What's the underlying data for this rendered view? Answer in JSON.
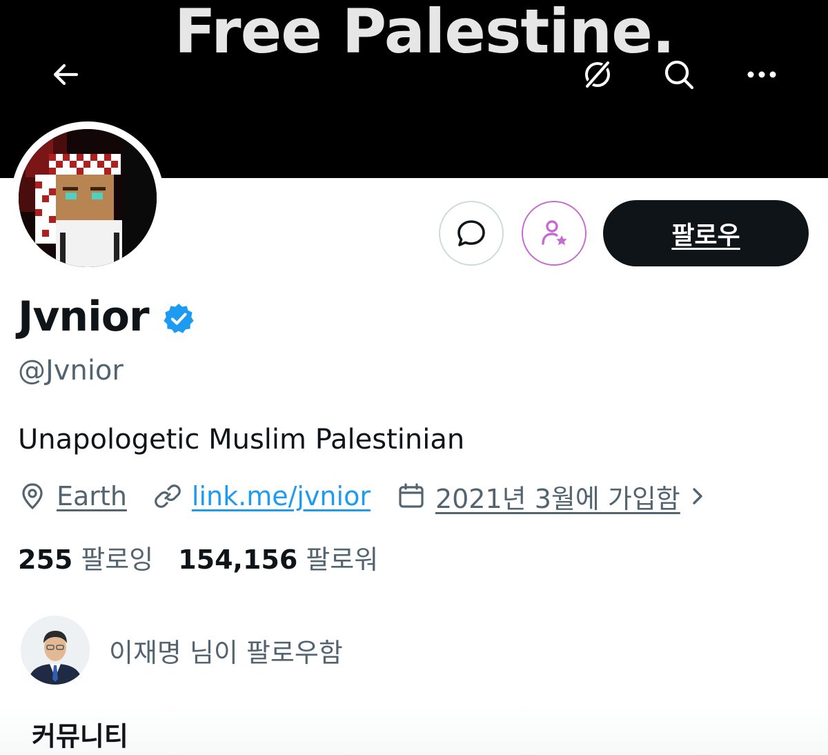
{
  "banner": {
    "text": "Free Palestine.",
    "icons": [
      "back-arrow-icon",
      "grok-icon",
      "search-icon",
      "more-icon"
    ]
  },
  "actions": {
    "follow_label": "팔로우",
    "dm_icon": "message-bubble-icon",
    "subscribe_icon": "subscribe-person-star-icon"
  },
  "profile": {
    "display_name": "Jvnior",
    "verified": true,
    "handle": "@Jvnior",
    "bio": "Unapologetic Muslim Palestinian",
    "location": "Earth",
    "link": "link.me/jvnior",
    "joined": "2021년 3월에 가입함"
  },
  "stats": {
    "following_count": "255",
    "following_label": "팔로잉",
    "followers_count": "154,156",
    "followers_label": "팔로워"
  },
  "followed_by": {
    "text": "이재명 님이 팔로우함"
  },
  "community": {
    "title": "커뮤니티"
  },
  "colors": {
    "banner_bg": "#000000",
    "text_primary": "#0f1419",
    "text_secondary": "#536471",
    "link": "#1d9bf0",
    "verified": "#1d9bf0",
    "subscribe_accent": "#c56bd1",
    "follow_button_bg": "#0f1419"
  }
}
